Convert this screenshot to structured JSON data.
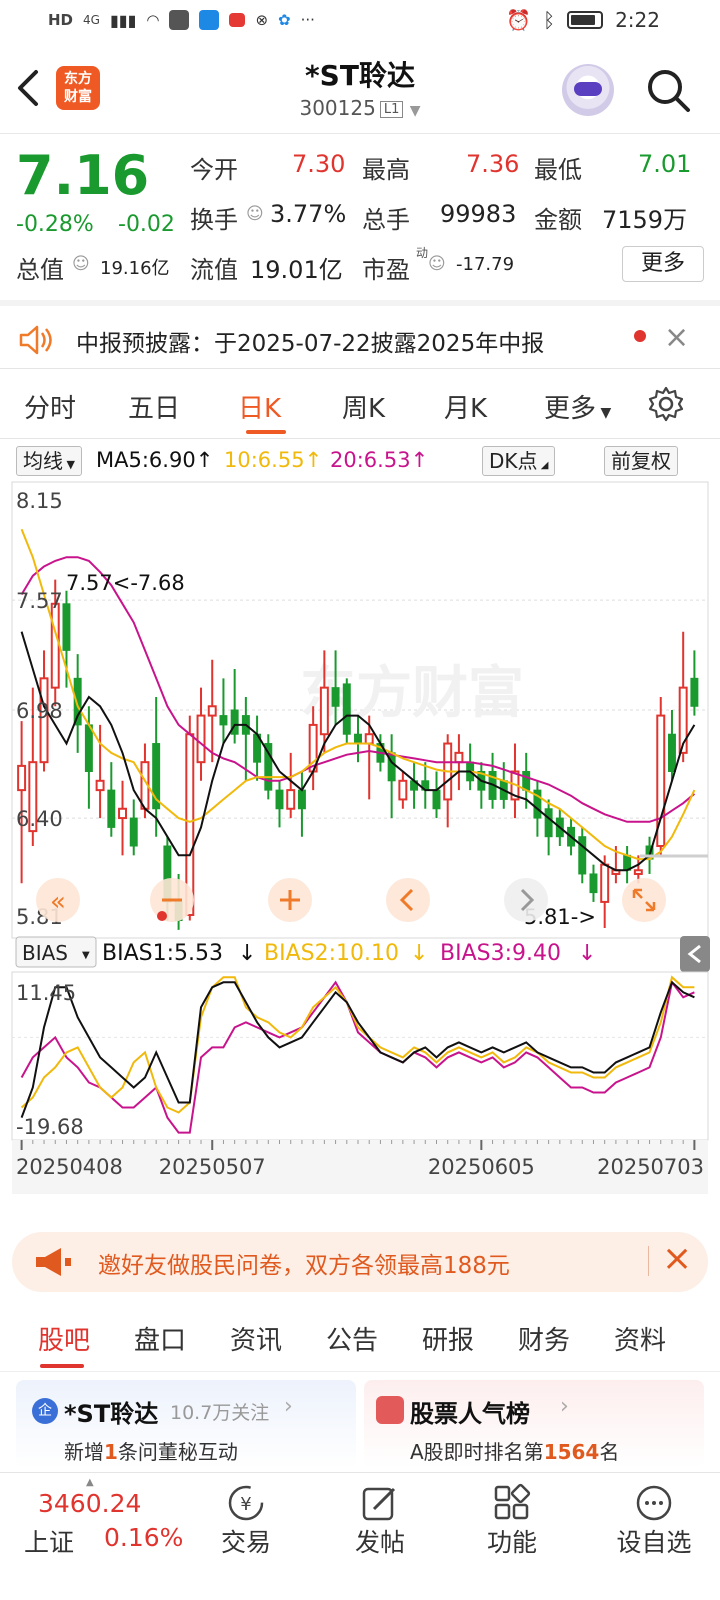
{
  "status": {
    "left_icons": [
      "HD",
      "4G"
    ],
    "time": "2:22"
  },
  "header": {
    "logo_text_1": "东方",
    "logo_text_2": "财富",
    "title": "*ST聆达",
    "code": "300125",
    "level_badge": "L1"
  },
  "quote": {
    "price": "7.16",
    "change_pct": "-0.28%",
    "change_abs": "-0.02",
    "open_label": "今开",
    "open_value": "7.30",
    "high_label": "最高",
    "high_value": "7.36",
    "low_label": "最低",
    "low_value": "7.01",
    "turnover_label": "换手",
    "turnover_value": "3.77%",
    "volume_label": "总手",
    "volume_value": "99983",
    "amount_label": "金额",
    "amount_value": "7159万",
    "mktcap_label": "总值",
    "mktcap_value": "19.16亿",
    "float_label": "流值",
    "float_value": "19.01亿",
    "pe_label": "市盈",
    "pe_sup": "动",
    "pe_value": "-17.79",
    "more_label": "更多"
  },
  "notice": {
    "text": "中报预披露：于2025-07-22披露2025年中报"
  },
  "tabs": [
    "分时",
    "五日",
    "日K",
    "周K",
    "月K",
    "更多"
  ],
  "chart_controls": {
    "ma_select": "均线",
    "ma5": "MA5:6.90",
    "ma10": "10:6.55",
    "ma20": "20:6.53",
    "dk_label": "DK点",
    "adjust_label": "前复权",
    "bias_select": "BIAS",
    "bias1": "BIAS1:5.53",
    "bias2": "BIAS2:10.10",
    "bias3": "BIAS3:9.40",
    "watermark": "东方财富"
  },
  "colors": {
    "up": "#e0342f",
    "down": "#1a9a2e",
    "ma5": "#111111",
    "ma10": "#f0b90b",
    "ma20": "#c8148c",
    "accent": "#ef5a24"
  },
  "chart_data": [
    {
      "type": "candlestick",
      "title": "日K",
      "y_ticks": [
        "8.15",
        "7.57",
        "6.98",
        "6.40",
        "5.81"
      ],
      "ylim": [
        5.81,
        8.15
      ],
      "max_annotation": "7.57<-7.68",
      "min_annotation": "5.81->",
      "x_ticks": [
        "20250408",
        "20250507",
        "20250605",
        "20250703"
      ],
      "candles": [
        {
          "o": 6.55,
          "c": 6.68,
          "h": 6.92,
          "l": 6.05,
          "up": true
        },
        {
          "o": 6.33,
          "c": 6.7,
          "h": 7.1,
          "l": 6.25,
          "up": true
        },
        {
          "o": 6.7,
          "c": 7.15,
          "h": 7.3,
          "l": 6.65,
          "up": true
        },
        {
          "o": 7.1,
          "c": 7.55,
          "h": 7.68,
          "l": 7.0,
          "up": true
        },
        {
          "o": 7.55,
          "c": 7.3,
          "h": 7.62,
          "l": 7.1,
          "up": false
        },
        {
          "o": 7.15,
          "c": 6.9,
          "h": 7.28,
          "l": 6.75,
          "up": false
        },
        {
          "o": 6.9,
          "c": 6.65,
          "h": 7.0,
          "l": 6.45,
          "up": false
        },
        {
          "o": 6.55,
          "c": 6.6,
          "h": 6.9,
          "l": 6.4,
          "up": true
        },
        {
          "o": 6.55,
          "c": 6.35,
          "h": 6.7,
          "l": 6.3,
          "up": false
        },
        {
          "o": 6.4,
          "c": 6.45,
          "h": 6.6,
          "l": 6.2,
          "up": true
        },
        {
          "o": 6.4,
          "c": 6.25,
          "h": 6.5,
          "l": 6.2,
          "up": false
        },
        {
          "o": 6.45,
          "c": 6.7,
          "h": 6.8,
          "l": 6.4,
          "up": true
        },
        {
          "o": 6.8,
          "c": 6.45,
          "h": 7.05,
          "l": 6.3,
          "up": false
        },
        {
          "o": 6.25,
          "c": 5.95,
          "h": 6.3,
          "l": 5.85,
          "up": false
        },
        {
          "o": 5.95,
          "c": 5.85,
          "h": 6.1,
          "l": 5.8,
          "up": false
        },
        {
          "o": 5.88,
          "c": 6.85,
          "h": 6.95,
          "l": 5.85,
          "up": true
        },
        {
          "o": 6.7,
          "c": 6.95,
          "h": 7.1,
          "l": 6.6,
          "up": true
        },
        {
          "o": 6.95,
          "c": 7.0,
          "h": 7.25,
          "l": 6.7,
          "up": true
        },
        {
          "o": 6.95,
          "c": 6.9,
          "h": 7.15,
          "l": 6.8,
          "up": false
        },
        {
          "o": 6.98,
          "c": 6.85,
          "h": 7.2,
          "l": 6.8,
          "up": false
        },
        {
          "o": 6.95,
          "c": 6.85,
          "h": 7.05,
          "l": 6.6,
          "up": false
        },
        {
          "o": 6.85,
          "c": 6.7,
          "h": 6.95,
          "l": 6.6,
          "up": false
        },
        {
          "o": 6.8,
          "c": 6.55,
          "h": 6.85,
          "l": 6.5,
          "up": false
        },
        {
          "o": 6.55,
          "c": 6.45,
          "h": 6.6,
          "l": 6.35,
          "up": false
        },
        {
          "o": 6.45,
          "c": 6.55,
          "h": 6.75,
          "l": 6.4,
          "up": true
        },
        {
          "o": 6.55,
          "c": 6.45,
          "h": 6.65,
          "l": 6.3,
          "up": false
        },
        {
          "o": 6.65,
          "c": 6.9,
          "h": 7.0,
          "l": 6.55,
          "up": true
        },
        {
          "o": 6.85,
          "c": 7.1,
          "h": 7.3,
          "l": 6.75,
          "up": true
        },
        {
          "o": 7.1,
          "c": 7.0,
          "h": 7.3,
          "l": 6.9,
          "up": false
        },
        {
          "o": 7.12,
          "c": 6.85,
          "h": 7.15,
          "l": 6.8,
          "up": false
        },
        {
          "o": 6.85,
          "c": 6.8,
          "h": 6.95,
          "l": 6.7,
          "up": false
        },
        {
          "o": 6.85,
          "c": 6.8,
          "h": 6.95,
          "l": 6.5,
          "up": true
        },
        {
          "o": 6.8,
          "c": 6.7,
          "h": 6.85,
          "l": 6.65,
          "up": false
        },
        {
          "o": 6.75,
          "c": 6.6,
          "h": 6.85,
          "l": 6.4,
          "up": false
        },
        {
          "o": 6.5,
          "c": 6.6,
          "h": 6.65,
          "l": 6.45,
          "up": true
        },
        {
          "o": 6.6,
          "c": 6.55,
          "h": 6.7,
          "l": 6.45,
          "up": false
        },
        {
          "o": 6.6,
          "c": 6.55,
          "h": 6.7,
          "l": 6.45,
          "up": false
        },
        {
          "o": 6.55,
          "c": 6.45,
          "h": 6.65,
          "l": 6.4,
          "up": false
        },
        {
          "o": 6.5,
          "c": 6.8,
          "h": 6.85,
          "l": 6.35,
          "up": true
        },
        {
          "o": 6.7,
          "c": 6.75,
          "h": 6.85,
          "l": 6.55,
          "up": true
        },
        {
          "o": 6.7,
          "c": 6.6,
          "h": 6.8,
          "l": 6.55,
          "up": false
        },
        {
          "o": 6.65,
          "c": 6.55,
          "h": 6.7,
          "l": 6.45,
          "up": false
        },
        {
          "o": 6.65,
          "c": 6.5,
          "h": 6.75,
          "l": 6.45,
          "up": false
        },
        {
          "o": 6.6,
          "c": 6.5,
          "h": 6.7,
          "l": 6.45,
          "up": false
        },
        {
          "o": 6.5,
          "c": 6.65,
          "h": 6.8,
          "l": 6.4,
          "up": true
        },
        {
          "o": 6.65,
          "c": 6.55,
          "h": 6.75,
          "l": 6.45,
          "up": false
        },
        {
          "o": 6.55,
          "c": 6.4,
          "h": 6.6,
          "l": 6.3,
          "up": false
        },
        {
          "o": 6.45,
          "c": 6.3,
          "h": 6.5,
          "l": 6.2,
          "up": false
        },
        {
          "o": 6.4,
          "c": 6.3,
          "h": 6.45,
          "l": 6.25,
          "up": false
        },
        {
          "o": 6.35,
          "c": 6.25,
          "h": 6.4,
          "l": 6.2,
          "up": false
        },
        {
          "o": 6.3,
          "c": 6.1,
          "h": 6.35,
          "l": 6.05,
          "up": false
        },
        {
          "o": 6.1,
          "c": 6.0,
          "h": 6.15,
          "l": 5.95,
          "up": false
        },
        {
          "o": 5.95,
          "c": 6.15,
          "h": 6.2,
          "l": 5.81,
          "up": true
        },
        {
          "o": 6.1,
          "c": 6.12,
          "h": 6.25,
          "l": 6.05,
          "up": true
        },
        {
          "o": 6.12,
          "c": 6.2,
          "h": 6.25,
          "l": 6.05,
          "up": false
        },
        {
          "o": 6.1,
          "c": 6.12,
          "h": 6.2,
          "l": 6.05,
          "up": true
        },
        {
          "o": 6.18,
          "c": 6.25,
          "h": 6.3,
          "l": 6.1,
          "up": false
        },
        {
          "o": 6.25,
          "c": 6.95,
          "h": 7.05,
          "l": 6.2,
          "up": true
        },
        {
          "o": 6.85,
          "c": 6.65,
          "h": 6.98,
          "l": 6.6,
          "up": false
        },
        {
          "o": 6.75,
          "c": 7.1,
          "h": 7.4,
          "l": 6.7,
          "up": true
        },
        {
          "o": 7.15,
          "c": 7.0,
          "h": 7.3,
          "l": 6.95,
          "up": false
        }
      ],
      "ma5": [
        7.4,
        7.2,
        7.0,
        6.9,
        6.8,
        6.95,
        7.05,
        7.0,
        6.9,
        6.75,
        6.55,
        6.45,
        6.4,
        6.3,
        6.2,
        6.2,
        6.35,
        6.6,
        6.8,
        6.9,
        6.9,
        6.85,
        6.75,
        6.65,
        6.6,
        6.55,
        6.65,
        6.8,
        6.9,
        6.95,
        6.95,
        6.9,
        6.8,
        6.7,
        6.65,
        6.6,
        6.55,
        6.55,
        6.6,
        6.65,
        6.65,
        6.6,
        6.58,
        6.55,
        6.52,
        6.5,
        6.45,
        6.4,
        6.35,
        6.3,
        6.25,
        6.2,
        6.15,
        6.12,
        6.12,
        6.15,
        6.2,
        6.4,
        6.6,
        6.8,
        6.9
      ],
      "ma10": [
        7.95,
        7.8,
        7.6,
        7.4,
        7.2,
        7.0,
        6.9,
        6.8,
        6.75,
        6.72,
        6.7,
        6.6,
        6.5,
        6.45,
        6.4,
        6.38,
        6.4,
        6.45,
        6.5,
        6.55,
        6.6,
        6.62,
        6.62,
        6.62,
        6.62,
        6.65,
        6.7,
        6.75,
        6.78,
        6.8,
        6.8,
        6.8,
        6.78,
        6.75,
        6.72,
        6.7,
        6.68,
        6.66,
        6.65,
        6.65,
        6.65,
        6.64,
        6.62,
        6.6,
        6.58,
        6.55,
        6.52,
        6.48,
        6.45,
        6.4,
        6.35,
        6.3,
        6.25,
        6.22,
        6.2,
        6.18,
        6.18,
        6.22,
        6.3,
        6.42,
        6.55
      ],
      "ma20": [
        7.6,
        7.7,
        7.75,
        7.78,
        7.8,
        7.8,
        7.78,
        7.72,
        7.65,
        7.55,
        7.45,
        7.3,
        7.15,
        7.0,
        6.9,
        6.85,
        6.8,
        6.75,
        6.72,
        6.7,
        6.66,
        6.62,
        6.6,
        6.6,
        6.62,
        6.65,
        6.68,
        6.7,
        6.72,
        6.74,
        6.75,
        6.76,
        6.75,
        6.74,
        6.73,
        6.72,
        6.71,
        6.7,
        6.7,
        6.7,
        6.7,
        6.69,
        6.68,
        6.66,
        6.64,
        6.62,
        6.6,
        6.58,
        6.55,
        6.52,
        6.48,
        6.45,
        6.42,
        6.4,
        6.38,
        6.38,
        6.38,
        6.4,
        6.44,
        6.48,
        6.53
      ]
    },
    {
      "type": "line",
      "title": "BIAS",
      "y_ticks": [
        "11.45",
        "-19.68"
      ],
      "ylim": [
        -19.68,
        11.45
      ],
      "series": [
        {
          "name": "BIAS1",
          "values": [
            -16,
            -10,
            2,
            10,
            10,
            4,
            0,
            -4,
            -6,
            -8,
            -10,
            -8,
            -3,
            -8,
            -13,
            -13,
            6,
            10,
            11,
            11,
            7,
            3,
            0,
            -2,
            -1,
            0,
            3,
            6,
            9,
            7,
            3,
            0,
            -3,
            -4,
            -5,
            -3,
            -2,
            -4,
            -2,
            -1,
            -2,
            -3,
            -2,
            -3,
            -2,
            -1,
            -3,
            -4,
            -5,
            -6,
            -6,
            -7,
            -7,
            -5,
            -4,
            -3,
            -2,
            5,
            11,
            9,
            8
          ]
        },
        {
          "name": "BIAS2",
          "values": [
            -14,
            -12,
            -8,
            -6,
            -3,
            -2,
            -6,
            -10,
            -12,
            -10,
            -5,
            -3,
            -10,
            -14,
            -15,
            -13,
            4,
            10,
            12,
            12,
            6,
            4,
            3,
            1,
            0,
            2,
            6,
            8,
            10,
            7,
            2,
            0,
            -2,
            -3,
            -4,
            -2,
            -3,
            -5,
            -3,
            -2,
            -3,
            -4,
            -3,
            -5,
            -4,
            -2,
            -3,
            -5,
            -6,
            -7,
            -7,
            -8,
            -8,
            -6,
            -5,
            -4,
            -3,
            3,
            12,
            10,
            10
          ]
        },
        {
          "name": "BIAS3",
          "values": [
            -8,
            -4,
            -2,
            0,
            -4,
            -6,
            -9,
            -10,
            -12,
            -14,
            -14,
            -12,
            -10,
            -16,
            -19,
            -19,
            -4,
            -2,
            -2,
            2,
            3,
            2,
            1,
            0,
            1,
            2,
            5,
            8,
            11,
            7,
            1,
            -1,
            -3,
            -4,
            -5,
            -3,
            -4,
            -6,
            -4,
            -3,
            -4,
            -5,
            -4,
            -6,
            -5,
            -3,
            -4,
            -6,
            -8,
            -10,
            -10,
            -11,
            -11,
            -9,
            -8,
            -7,
            -6,
            0,
            11,
            8,
            9
          ]
        }
      ]
    }
  ],
  "banner": {
    "text": "邀好友做股民问卷，双方各领最高188元"
  },
  "bottom_tabs": [
    "股吧",
    "盘口",
    "资讯",
    "公告",
    "研报",
    "财务",
    "资料"
  ],
  "cards": {
    "card1_badge": "企",
    "card1_title": "*ST聆达",
    "card1_followers": "10.7万关注",
    "card1_sub_1": "新增",
    "card1_sub_num": "1",
    "card1_sub_2": "条问董秘互动",
    "card2_title": "股票人气榜",
    "card2_sub_1": "A股即时排名第",
    "card2_sub_num": "1564",
    "card2_sub_2": "名"
  },
  "bottom_nav": {
    "index_value": "3460.24",
    "index_name": "上证",
    "index_change": "0.16%",
    "items": [
      "交易",
      "发帖",
      "功能",
      "设自选"
    ]
  }
}
